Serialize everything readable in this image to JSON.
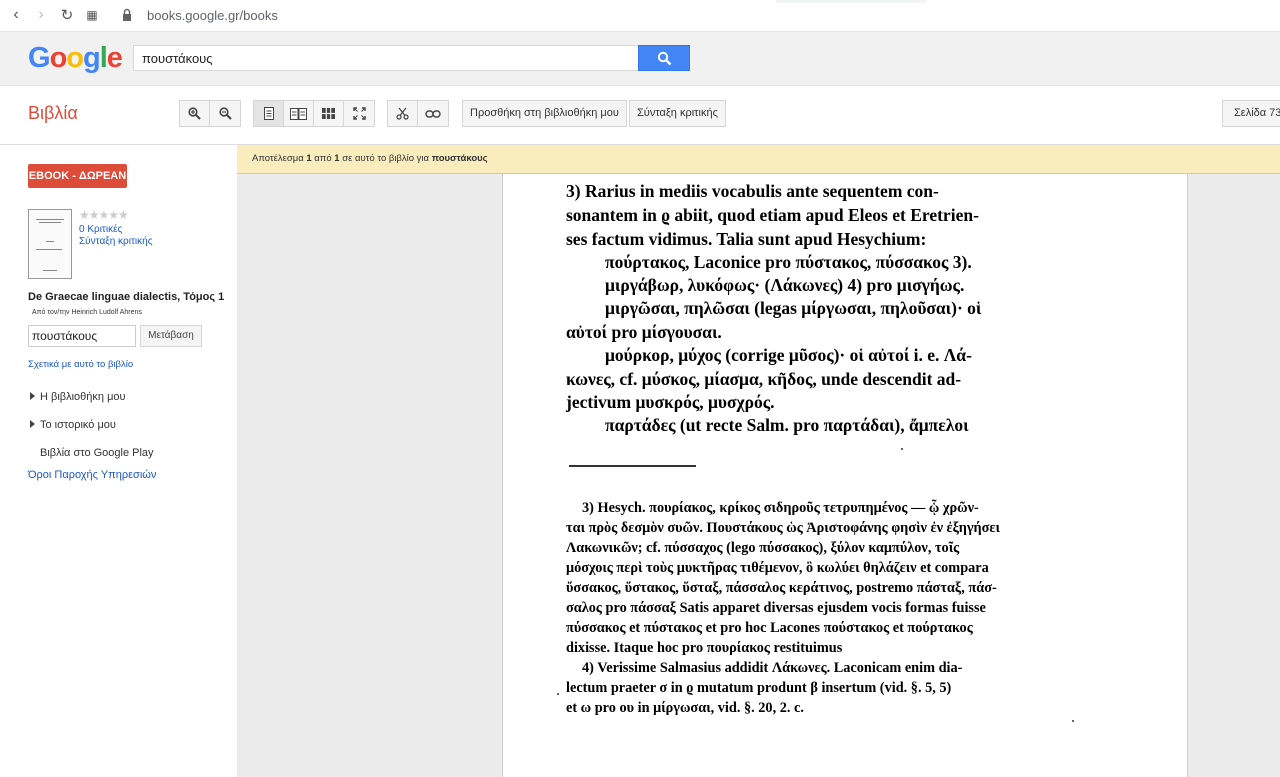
{
  "browser": {
    "url": "books.google.gr/books"
  },
  "header": {
    "logo": "Google",
    "search_query": "πουστάκους"
  },
  "toolbar": {
    "title": "Βιβλία",
    "add_to_library": "Προσθήκη στη βιβλιοθήκη μου",
    "write_review": "Σύνταξη κριτικής",
    "page_label": "Σελίδα 73"
  },
  "sidebar": {
    "ebook_button": "EBOOK - ΔΩΡΕΑΝ",
    "reviews": "0 Κριτικές",
    "write_review": "Σύνταξη κριτικής",
    "book_title": "De Graecae linguae dialectis, Τόμος 1",
    "author": "Από τον/την Heinrich Ludolf Ahrens",
    "inbook_query": "πουστάκους",
    "go_button": "Μετάβαση",
    "about_link": "Σχετικά με αυτό το βιβλίο",
    "my_library": "Η βιβλιοθήκη μου",
    "history": "Το ιστορικό μου",
    "play": "Βιβλία στο Google Play",
    "terms": "Όροι Παροχής Υπηρεσιών"
  },
  "result_bar": {
    "prefix": "Αποτέλεσμα",
    "n": "1",
    "of": "από",
    "total": "1",
    "suffix": "σε αυτό το βιβλίο για",
    "query": "πουστάκους"
  },
  "page_text": {
    "big": [
      "3)  Rarius in mediis vocabulis ante sequentem con-",
      "sonantem in ϱ abiit, quod etiam apud Eleos et Eretrien-",
      "ses factum vidimus.  Talia sunt apud Hesychium:",
      "πούρτακος, Laconice pro πύστακος, πύσσακος 3).",
      "μιργάβωρ, λυκόφως· (Λάκωνες) 4) pro μισγήως.",
      "μιργῶσαι, πηλῶσαι (legas μίργωσαι, πηλοῦσαι)· οἱ",
      "αὐτοί pro μίσγουσαι.",
      "μούρκορ, μύχος (corrige μῦσος)· οἱ αὐτοί i. e. Λά-",
      "κωνες, cf. μύσκος, μίασμα, κῆδος, unde descendit ad-",
      "jectivum μυσκρός, μυσχρός.",
      "παρτάδες (ut recte Salm. pro παρτάδαι), ἄμπελοι"
    ],
    "small": [
      "3)  Hesych. πουρίακος, κρίκος σιδηροῦς τετρυπημένος — ᾧ χρῶν-",
      "ται πρὸς δεσμὸν συῶν.  Πουστάκους ὡς Ἀριστοφάνης φησὶν ἐν ἐξηγήσει",
      "Λακωνικῶν; cf. πύσσαχος (lego πύσσακος), ξύλον καμπύλον, τοῖς",
      "μόσχοις περὶ τοὺς μυκτῆρας τιθέμενον, ὃ κωλύει θηλάζειν et compara",
      "ὕσσακος, ὕστακος, ὕσταξ, πάσσαλος κεράτινος, postremo πάσταξ, πάσ-",
      "σαλος pro πάσσαξ   Satis apparet diversas ejusdem vocis formas fuisse",
      "πύσσακος et πύστακος et pro hoc Lacones πούστακος et πούρτακος",
      "dixisse.  Itaque hoc pro πουρίακος restituimus",
      "4)  Verissime Salmasius addidit Λάκωνες.  Laconicam enim dia-",
      "lectum praeter σ in ϱ mutatum produnt β insertum (vid. §. 5, 5)",
      "et ω pro ου in μίργωσαι, vid. §. 20, 2. c."
    ]
  },
  "colors": {
    "accent_red": "#dd4b39",
    "link_blue": "#1a57c6",
    "search_blue": "#4285f4",
    "result_bar": "#f9edbe"
  }
}
